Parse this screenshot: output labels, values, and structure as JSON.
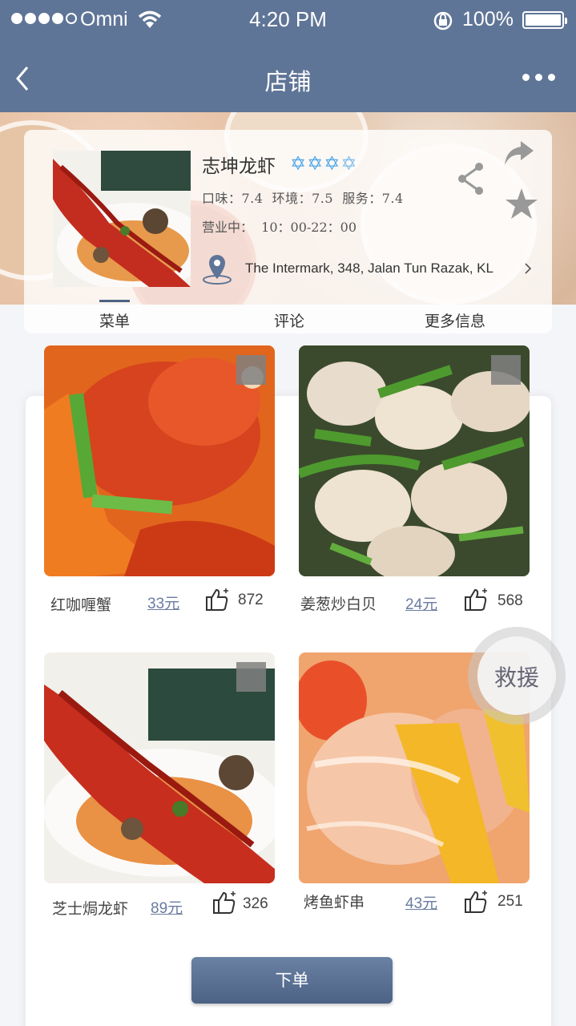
{
  "status_bar": {
    "carrier": "Omni",
    "time": "4:20 PM",
    "battery": "100%"
  },
  "nav": {
    "title": "店铺",
    "back_icon": "chevron-left-icon",
    "more_icon": "more-dots-icon"
  },
  "shop": {
    "name": "志坤龙虾",
    "rating_stars": 3.5,
    "scores": "口味：7.4  环境：7.5  服务：7.4",
    "hours": "营业中：  10：00-22：00",
    "address": "The Intermark, 348, Jalan Tun Razak, KL",
    "star_color": "#4aa6e8"
  },
  "tabs": [
    {
      "label": "菜单",
      "active": true
    },
    {
      "label": "评论",
      "active": false
    },
    {
      "label": "更多信息",
      "active": false
    }
  ],
  "dishes": [
    {
      "name": "红咖喱蟹",
      "price": "33元",
      "likes": "872"
    },
    {
      "name": "姜葱炒白贝",
      "price": "24元",
      "likes": "568"
    },
    {
      "name": "芝士焗龙虾",
      "price": "89元",
      "likes": "326"
    },
    {
      "name": "烤鱼虾串",
      "price": "43元",
      "likes": "251"
    }
  ],
  "order_button": {
    "label": "下单"
  },
  "rescue_button": {
    "label": "救援"
  },
  "colors": {
    "nav_bg": "#5f7597",
    "accent": "#4c6285",
    "price": "#6a7ca0"
  }
}
